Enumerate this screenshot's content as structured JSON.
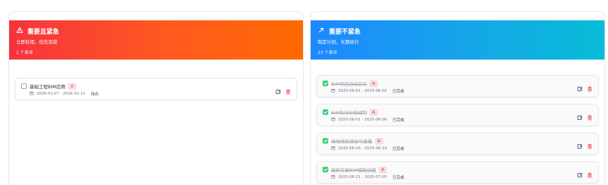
{
  "columns": [
    {
      "title": "重要且紧急",
      "subtitle": "立即处理，优先完成",
      "count": "1 个事项",
      "icon": "alert-triangle-icon",
      "accent": "#f5333f",
      "cards": [
        {
          "title": "基础工程BIM应用",
          "tag": "高",
          "dates": "2026-01-07 - 2026-02-11",
          "status": "待办",
          "done": false
        }
      ]
    },
    {
      "title": "重要不紧急",
      "subtitle": "制定计划，长期执行",
      "count": "23 个事项",
      "icon": "arrow-up-right-icon",
      "accent": "#1e88ff",
      "cards": [
        {
          "title": "BIM项目启动会议",
          "tag": "高",
          "dates": "2025-06-01 - 2025-06-02",
          "status": "已完成",
          "done": true
        },
        {
          "title": "BIM执行计划编制",
          "tag": "高",
          "dates": "2025-06-01 - 2025-06-06",
          "status": "已完成",
          "done": true
        },
        {
          "title": "场地地形测绘与建模",
          "tag": "高",
          "dates": "2025-06-16 - 2025-06-23",
          "status": "已完成",
          "done": true
        },
        {
          "title": "建筑方案BIM模型创建",
          "tag": "高",
          "dates": "2025-06-21 - 2025-07-05",
          "status": "已完成",
          "done": true
        }
      ]
    }
  ]
}
